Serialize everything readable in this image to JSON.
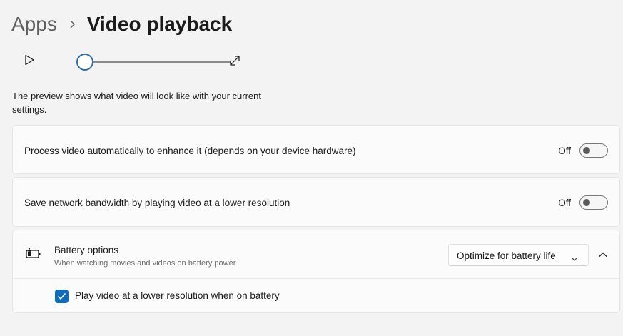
{
  "breadcrumb": {
    "parent": "Apps",
    "current": "Video playback"
  },
  "player": {
    "play_icon": "play-icon",
    "expand_icon": "expand-icon",
    "progress": 0
  },
  "description": "The preview shows what video will look like with your current settings.",
  "settings": [
    {
      "label": "Process video automatically to enhance it (depends on your device hardware)",
      "state": "Off",
      "enabled": false
    },
    {
      "label": "Save network bandwidth by playing video at a lower resolution",
      "state": "Off",
      "enabled": false
    }
  ],
  "battery": {
    "icon": "battery-charging-icon",
    "title": "Battery options",
    "subtitle": "When watching movies and videos on battery power",
    "dropdown_value": "Optimize for battery life",
    "expanded": true,
    "checkbox_label": "Play video at a lower resolution when on battery",
    "checkbox_checked": true
  },
  "colors": {
    "accent": "#0f6cbd",
    "background": "#f3f3f3",
    "card": "#fbfbfb"
  }
}
